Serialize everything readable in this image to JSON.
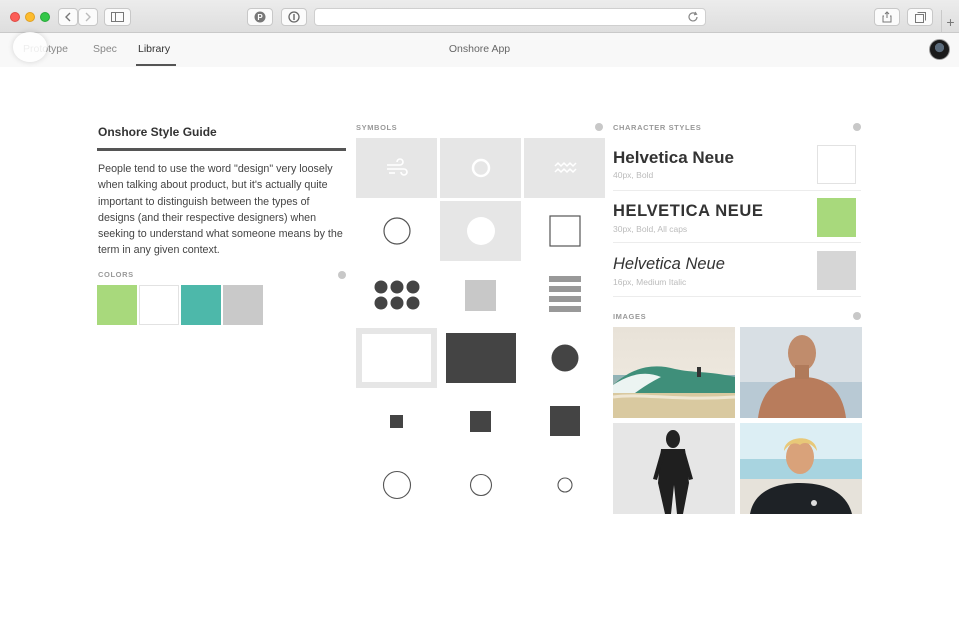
{
  "tabs": [
    {
      "label": "Prototype"
    },
    {
      "label": "Spec"
    },
    {
      "label": "Library"
    }
  ],
  "app_title": "Onshore App",
  "style_guide": {
    "title": "Onshore Style Guide",
    "description": "People tend to use the word \"design\" very loosely when talking about product, but it's actually quite important to distinguish between the types of designs (and their respective designers) when seeking to understand what someone means by the term in any given context."
  },
  "colors": {
    "label": "COLORS",
    "swatches": [
      "#a8d97c",
      "#ffffff",
      "#4db8aa",
      "#c9c9c9"
    ]
  },
  "symbols": {
    "label": "SYMBOLS"
  },
  "character_styles": {
    "label": "CHARACTER STYLES",
    "items": [
      {
        "name": "Helvetica Neue",
        "meta": "40px, Bold",
        "swatch": "#ffffff"
      },
      {
        "name": "HELVETICA NEUE",
        "meta": "30px, Bold, All caps",
        "swatch": "#a8d97c"
      },
      {
        "name": "Helvetica Neue",
        "meta": "16px, Medium Italic",
        "swatch": "#d6d6d6"
      }
    ]
  },
  "images": {
    "label": "IMAGES"
  }
}
